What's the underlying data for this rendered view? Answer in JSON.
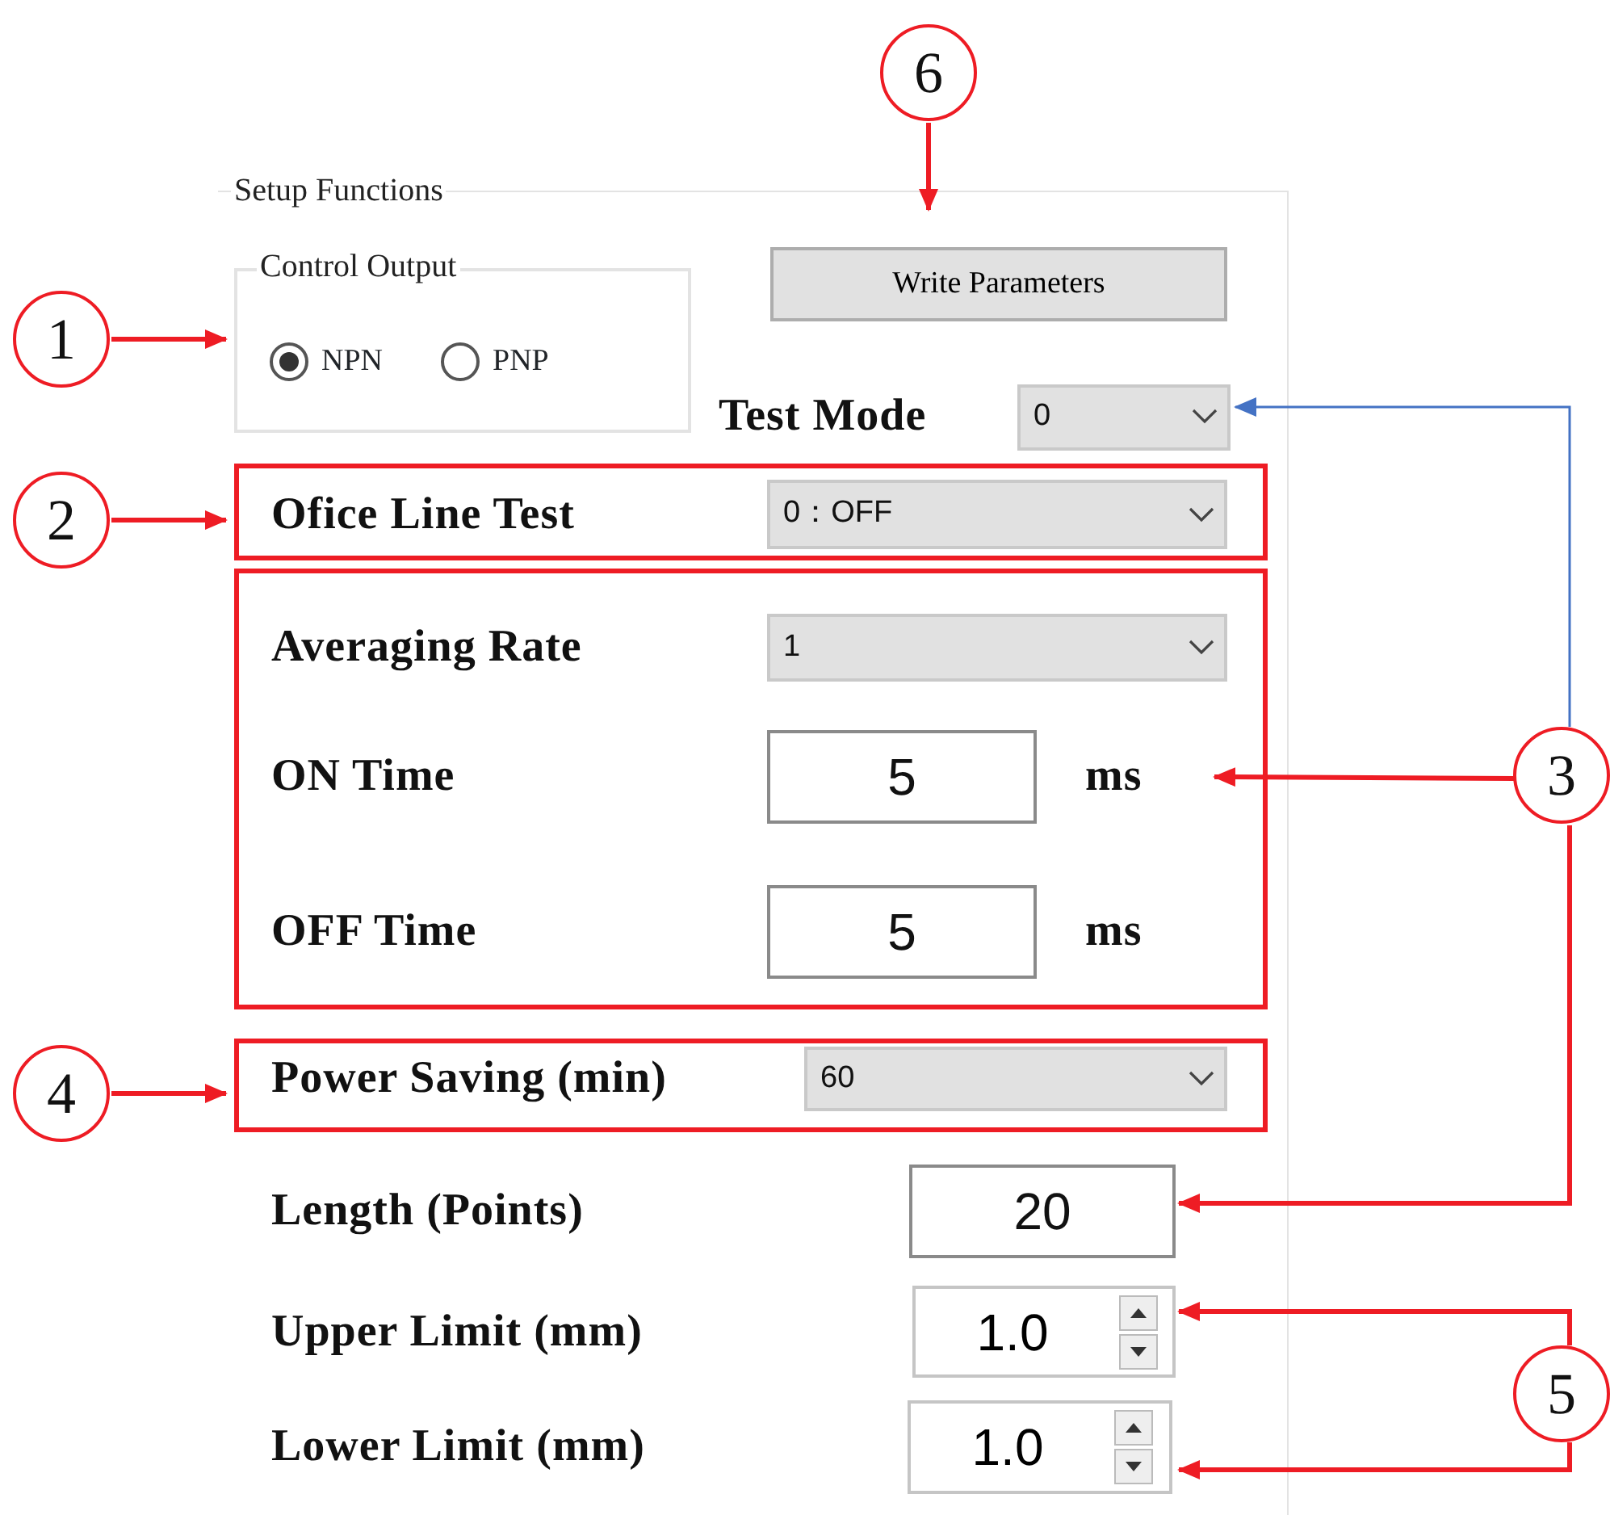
{
  "callouts": [
    {
      "number": "6"
    },
    {
      "number": "1"
    },
    {
      "number": "2"
    },
    {
      "number": "3"
    },
    {
      "number": "4"
    },
    {
      "number": "5"
    }
  ],
  "panel": {
    "title": "Setup Functions",
    "control_output": {
      "title": "Control Output",
      "options": [
        {
          "label": "NPN",
          "selected": true
        },
        {
          "label": "PNP",
          "selected": false
        }
      ]
    },
    "write_button": "Write Parameters",
    "test_mode": {
      "label": "Test Mode",
      "value": "0"
    },
    "sections": [
      {
        "highlighted": true,
        "rows": [
          {
            "kind": "select",
            "label": "Ofice Line Test",
            "value": "0：OFF"
          }
        ]
      },
      {
        "highlighted": true,
        "rows": [
          {
            "kind": "select",
            "label": "Averaging Rate",
            "value": "1"
          },
          {
            "kind": "input",
            "label": "ON Time",
            "value": "5",
            "unit": "ms"
          },
          {
            "kind": "input",
            "label": "OFF Time",
            "value": "5",
            "unit": "ms"
          }
        ]
      },
      {
        "highlighted": true,
        "rows": [
          {
            "kind": "select",
            "label": "Power Saving (min)",
            "value": "60"
          }
        ]
      },
      {
        "highlighted": false,
        "rows": [
          {
            "kind": "input",
            "label": "Length (Points)",
            "value": "20"
          },
          {
            "kind": "spinner",
            "label": "Upper Limit (mm)",
            "value": "1.0"
          },
          {
            "kind": "spinner",
            "label": "Lower Limit (mm)",
            "value": "1.0"
          }
        ]
      }
    ]
  }
}
